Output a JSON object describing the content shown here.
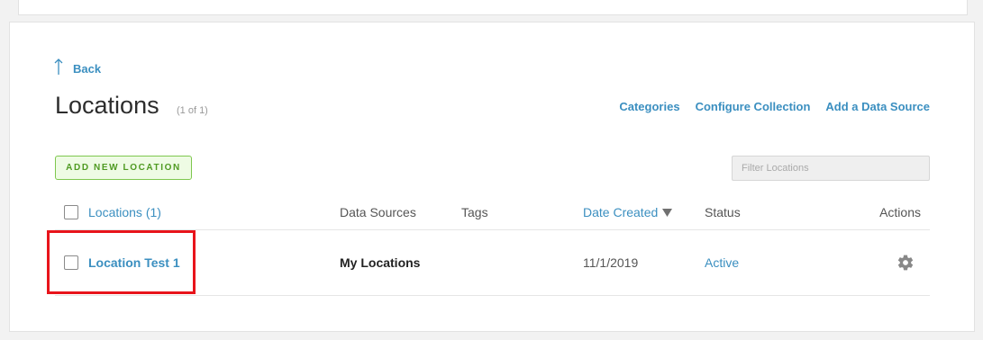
{
  "nav": {
    "back_label": "Back"
  },
  "header": {
    "title": "Locations",
    "count": "(1 of 1)",
    "links": [
      "Categories",
      "Configure Collection",
      "Add a Data Source"
    ]
  },
  "toolbar": {
    "add_button_label": "ADD NEW LOCATION",
    "filter_placeholder": "Filter Locations"
  },
  "table": {
    "columns": {
      "locations": "Locations (1)",
      "data_sources": "Data Sources",
      "tags": "Tags",
      "date_created": "Date Created",
      "status": "Status",
      "actions": "Actions"
    },
    "sort": {
      "column": "date_created",
      "direction": "descending"
    },
    "rows": [
      {
        "name": "Location Test 1",
        "data_sources": "My Locations",
        "tags": "",
        "date_created": "11/1/2019",
        "status": "Active",
        "actions_icon": "gear-icon"
      }
    ]
  },
  "annotation": {
    "highlight_color": "#e8141b",
    "highlight_target": "row-0-name"
  },
  "colors": {
    "link": "#3b8fc0",
    "button_border": "#7ec74e",
    "button_text": "#4f9a22"
  }
}
